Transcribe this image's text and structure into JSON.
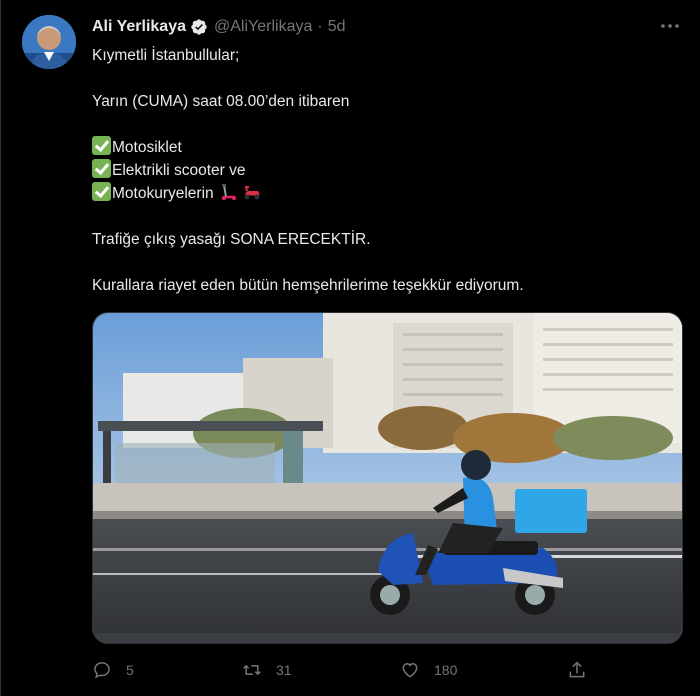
{
  "user": {
    "name": "Ali Yerlikaya",
    "handle": "@AliYerlikaya",
    "separator": "·",
    "time": "5d"
  },
  "tweet": {
    "line1": "Kıymetli İstanbullular;",
    "line2": "Yarın (CUMA) saat 08.00’den itibaren",
    "item1": "Motosiklet",
    "item2": "Elektrikli scooter ve",
    "item3": "Motokuryelerin",
    "line3": "Trafiğe çıkış yasağı SONA ERECEKTİR.",
    "line4": "Kurallara riayet eden bütün hemşehrilerime teşekkür ediyorum."
  },
  "actions": {
    "reply_count": "5",
    "retweet_count": "31",
    "like_count": "180"
  },
  "icons": [
    "verified-icon",
    "more-icon",
    "check-emoji-icon",
    "scooter-emoji-icon",
    "motor-scooter-emoji-icon",
    "reply-icon",
    "retweet-icon",
    "like-icon",
    "share-icon"
  ],
  "colors": {
    "background": "#000000",
    "text": "#e7e9ea",
    "secondary": "#71767b",
    "verified": "#1d9bf0",
    "check": "#77b255"
  }
}
